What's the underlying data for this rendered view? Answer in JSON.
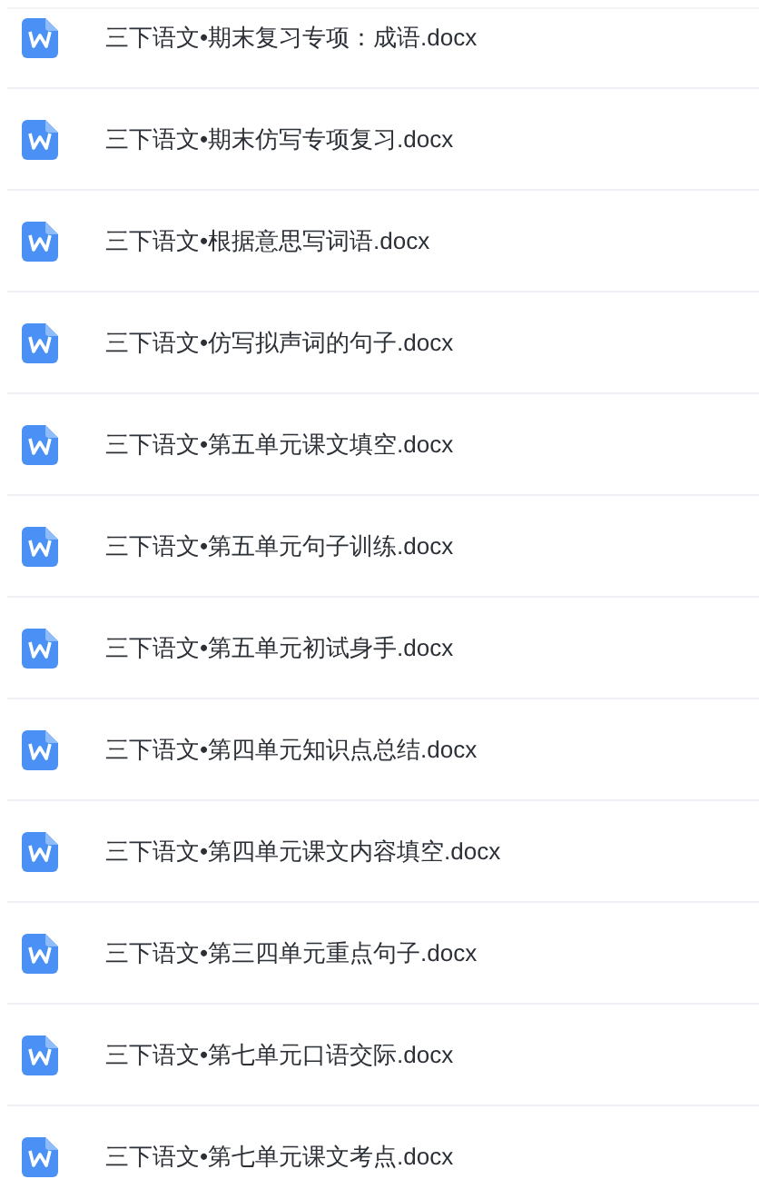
{
  "files": [
    {
      "name": "三下语文•期末复习专项：成语.docx"
    },
    {
      "name": "三下语文•期末仿写专项复习.docx"
    },
    {
      "name": "三下语文•根据意思写词语.docx"
    },
    {
      "name": "三下语文•仿写拟声词的句子.docx"
    },
    {
      "name": "三下语文•第五单元课文填空.docx"
    },
    {
      "name": "三下语文•第五单元句子训练.docx"
    },
    {
      "name": "三下语文•第五单元初试身手.docx"
    },
    {
      "name": "三下语文•第四单元知识点总结.docx"
    },
    {
      "name": "三下语文•第四单元课文内容填空.docx"
    },
    {
      "name": "三下语文•第三四单元重点句子.docx"
    },
    {
      "name": "三下语文•第七单元口语交际.docx"
    },
    {
      "name": "三下语文•第七单元课文考点.docx"
    }
  ]
}
